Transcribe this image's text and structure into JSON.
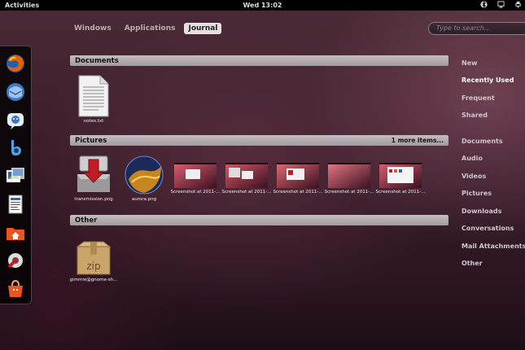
{
  "panel": {
    "activities": "Activities",
    "clock": "Wed 13:02"
  },
  "tabs": [
    {
      "label": "Windows"
    },
    {
      "label": "Applications"
    },
    {
      "label": "Journal"
    }
  ],
  "search": {
    "placeholder": "Type to search..."
  },
  "dock": {
    "items": [
      {
        "icon": "firefox-icon"
      },
      {
        "icon": "thunderbird-icon"
      },
      {
        "icon": "empathy-icon"
      },
      {
        "icon": "banshee-icon"
      },
      {
        "icon": "shotwell-icon"
      },
      {
        "icon": "text-editor-icon"
      },
      {
        "icon": "home-folder-icon"
      },
      {
        "icon": "system-settings-icon"
      },
      {
        "icon": "software-center-icon"
      }
    ]
  },
  "sections": {
    "documents": {
      "title": "Documents",
      "items": [
        {
          "label": "notes.txt"
        }
      ]
    },
    "pictures": {
      "title": "Pictures",
      "more": "1 more items...",
      "items": [
        {
          "label": "transmission.png"
        },
        {
          "label": "aurora.png"
        },
        {
          "label": "Screenshot at 2011-..."
        },
        {
          "label": "Screenshot at 2011-..."
        },
        {
          "label": "Screenshot at 2011-..."
        },
        {
          "label": "Screenshot at 2011-..."
        },
        {
          "label": "Screenshot at 2011-..."
        }
      ]
    },
    "other": {
      "title": "Other",
      "items": [
        {
          "label": "gimmie@gnome-sh..."
        }
      ]
    }
  },
  "filters": [
    {
      "label": "New"
    },
    {
      "label": "Recently Used"
    },
    {
      "label": "Frequent"
    },
    {
      "label": "Shared"
    },
    {
      "label": "Documents"
    },
    {
      "label": "Audio"
    },
    {
      "label": "Videos"
    },
    {
      "label": "Pictures"
    },
    {
      "label": "Downloads"
    },
    {
      "label": "Conversations"
    },
    {
      "label": "Mail Attachments"
    },
    {
      "label": "Other"
    }
  ],
  "colors": {
    "panel": "#000000",
    "section_header": "#b5acaf",
    "active_tab": "#e6e0e2"
  }
}
